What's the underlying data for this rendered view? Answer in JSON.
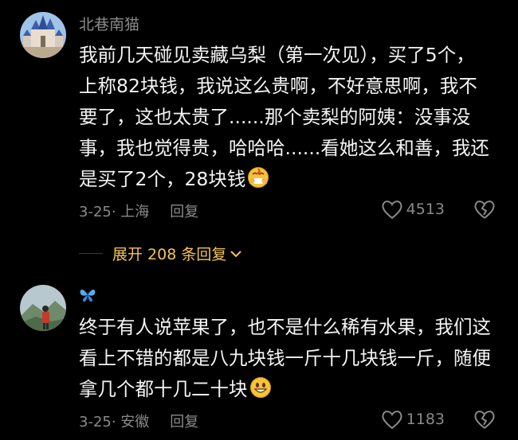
{
  "comments": [
    {
      "username": "北巷南猫",
      "lines": [
        "我前几天碰见卖藏乌梨（第一次见），买了5个，",
        "上称82块钱，我说这么贵啊，不好意思啊，我不",
        "要了，这也太贵了......那个卖梨的阿姨：没事没",
        "事，我也觉得贵，哈哈哈......看她这么和善，我还",
        "是买了2个，28块钱"
      ],
      "trailing_emoji": "money-mouth-emoji",
      "date_location": "3-25· 上海",
      "reply_label": "回复",
      "likes": "4513"
    },
    {
      "username": "🦋",
      "lines": [
        "终于有人说苹果了，也不是什么稀有水果，我们这",
        "看上不错的都是八九块钱一斤十几块钱一斤，随便",
        "拿几个都十几二十块"
      ],
      "trailing_emoji": "grinning-emoji",
      "date_location": "3-25· 安徽",
      "reply_label": "回复",
      "likes": "1183"
    }
  ],
  "expand_replies": {
    "label": "展开 208 条回复"
  },
  "colors": {
    "background": "#000000",
    "text": "#f4f4f4",
    "muted": "#8a8a8a",
    "accent": "#f5c451"
  }
}
